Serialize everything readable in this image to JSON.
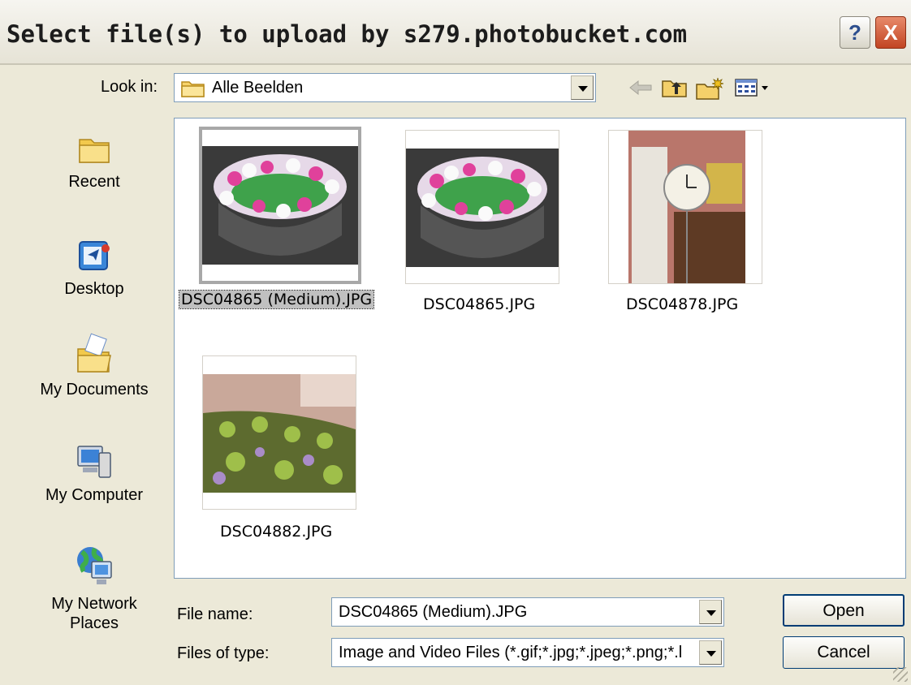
{
  "window": {
    "title": "Select file(s) to upload by s279.photobucket.com",
    "help_button": "?",
    "close_button": "X"
  },
  "lookin": {
    "label": "Look in:",
    "value": "Alle Beelden",
    "toolbar_icons": [
      "back-arrow-icon",
      "up-folder-icon",
      "new-folder-icon",
      "views-menu-icon"
    ]
  },
  "places": [
    {
      "label": "Recent",
      "icon": "recent-folder-icon"
    },
    {
      "label": "Desktop",
      "icon": "desktop-icon"
    },
    {
      "label": "My Documents",
      "icon": "my-documents-icon"
    },
    {
      "label": "My Computer",
      "icon": "my-computer-icon"
    },
    {
      "label": "My Network Places",
      "icon": "network-places-icon"
    }
  ],
  "files": [
    {
      "name": "DSC04865 (Medium).JPG",
      "selected": true
    },
    {
      "name": "DSC04865.JPG",
      "selected": false
    },
    {
      "name": "DSC04878.JPG",
      "selected": false
    },
    {
      "name": "DSC04882.JPG",
      "selected": false
    }
  ],
  "filename": {
    "label": "File name:",
    "value": "DSC04865 (Medium).JPG"
  },
  "filetype": {
    "label": "Files of type:",
    "value": "Image and Video Files (*.gif;*.jpg;*.jpeg;*.png;*.l"
  },
  "buttons": {
    "open": "Open",
    "cancel": "Cancel"
  }
}
